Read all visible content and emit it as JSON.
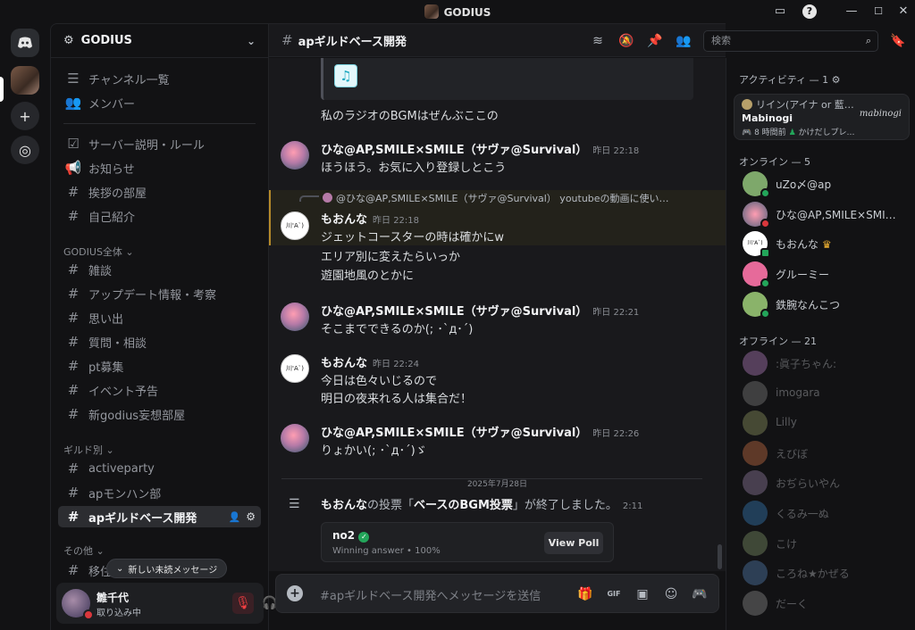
{
  "window": {
    "title": "GODIUS"
  },
  "server": {
    "name": "GODIUS"
  },
  "sidebar": {
    "top_items": [
      {
        "label": "チャンネル一覧",
        "icon": "list-icon"
      },
      {
        "label": "メンバー",
        "icon": "members-icon"
      }
    ],
    "channels_info": [
      {
        "label": "サーバー説明・ルール",
        "icon": "checklist-icon"
      },
      {
        "label": "お知らせ",
        "icon": "megaphone-icon"
      },
      {
        "label": "挨拶の部屋",
        "icon": "hash-icon"
      },
      {
        "label": "自己紹介",
        "icon": "hash-icon"
      }
    ],
    "category_all": "GODIUS全体",
    "channels_all": [
      "雑談",
      "アップデート情報・考察",
      "思い出",
      "質問・相談",
      "pt募集",
      "イベント予告",
      "新godius妄想部屋"
    ],
    "category_guild": "ギルド別",
    "channels_guild": [
      "activeparty",
      "apモンハン部",
      "apギルドベース開発"
    ],
    "category_other": "その他",
    "channel_other_partial": "移住",
    "unread_pill": "新しい未読メッセージ"
  },
  "user_panel": {
    "name": "雛千代",
    "status": "取り込み中"
  },
  "chat": {
    "channel_name": "apギルドベース開発",
    "search_placeholder": "検索",
    "messages": [
      {
        "text": "私のラジオのBGMはぜんぶここの"
      },
      {
        "author": "ひな@AP,SMILE×SMILE（サヴァ@Survival）",
        "time": "昨日 22:18",
        "lines": [
          "ほうほう。お気に入り登録しとこう"
        ]
      },
      {
        "reply_to": "@ひな@AP,SMILE×SMILE（サヴァ@Survival） youtubeの動画に使い…",
        "author": "もおんな",
        "time": "昨日 22:18",
        "lines": [
          "ジェットコースターの時は確かにw",
          "エリア別に変えたらいっか",
          "遊園地風のとかに"
        ]
      },
      {
        "author": "ひな@AP,SMILE×SMILE（サヴァ@Survival）",
        "time": "昨日 22:21",
        "lines": [
          "そこまでできるのか(; ･`д･´)"
        ]
      },
      {
        "author": "もおんな",
        "time": "昨日 22:24",
        "lines": [
          "今日は色々いじるので",
          "明日の夜来れる人は集合だ！"
        ]
      },
      {
        "author": "ひな@AP,SMILE×SMILE（サヴァ@Survival）",
        "time": "昨日 22:26",
        "lines": [
          "りょかい(; ･`д･´)ゞ"
        ]
      }
    ],
    "date_divider": "2025年7月28日",
    "poll_system": {
      "author": "もおんな",
      "text_mid": "の投票「",
      "poll_name": "ベースのBGM投票",
      "text_end": "」が終了しました。",
      "time": "2:11"
    },
    "poll_card": {
      "winner": "no2",
      "sub": "Winning answer • 100%",
      "button": "View Poll"
    },
    "composer_placeholder": "#apギルドベース開発へメッセージを送信"
  },
  "members": {
    "activity_header": "アクティビティ — 1",
    "activity": {
      "user": "リイン(アイナ or 藍…",
      "game": "Mabinogi",
      "detail1": "8 時間前",
      "detail2": "かけだしプレ…"
    },
    "online_header": "オンライン — 5",
    "online": [
      {
        "name": "uZo〆@ap",
        "color": "#7ea86b",
        "status": "#23a55a"
      },
      {
        "name": "ひな@AP,SMILE×SMI…",
        "color": "#b57aa7",
        "status": "#da373c"
      },
      {
        "name": "もおんな",
        "color": "#ffffff",
        "status": "#23a55a"
      },
      {
        "name": "グルーミー",
        "color": "#e66a9a",
        "status": "#23a55a"
      },
      {
        "name": "鉄腕なんこつ",
        "color": "#8ab36a",
        "status": "#23a55a"
      }
    ],
    "offline_header": "オフライン — 21",
    "offline": [
      ":眞子ちゃん:",
      "imogara",
      "Lilly",
      "えびぼ",
      "おぢらいやん",
      "くるみ一ぬ",
      "こけ",
      "ころね★かぜる",
      "だーく"
    ]
  }
}
